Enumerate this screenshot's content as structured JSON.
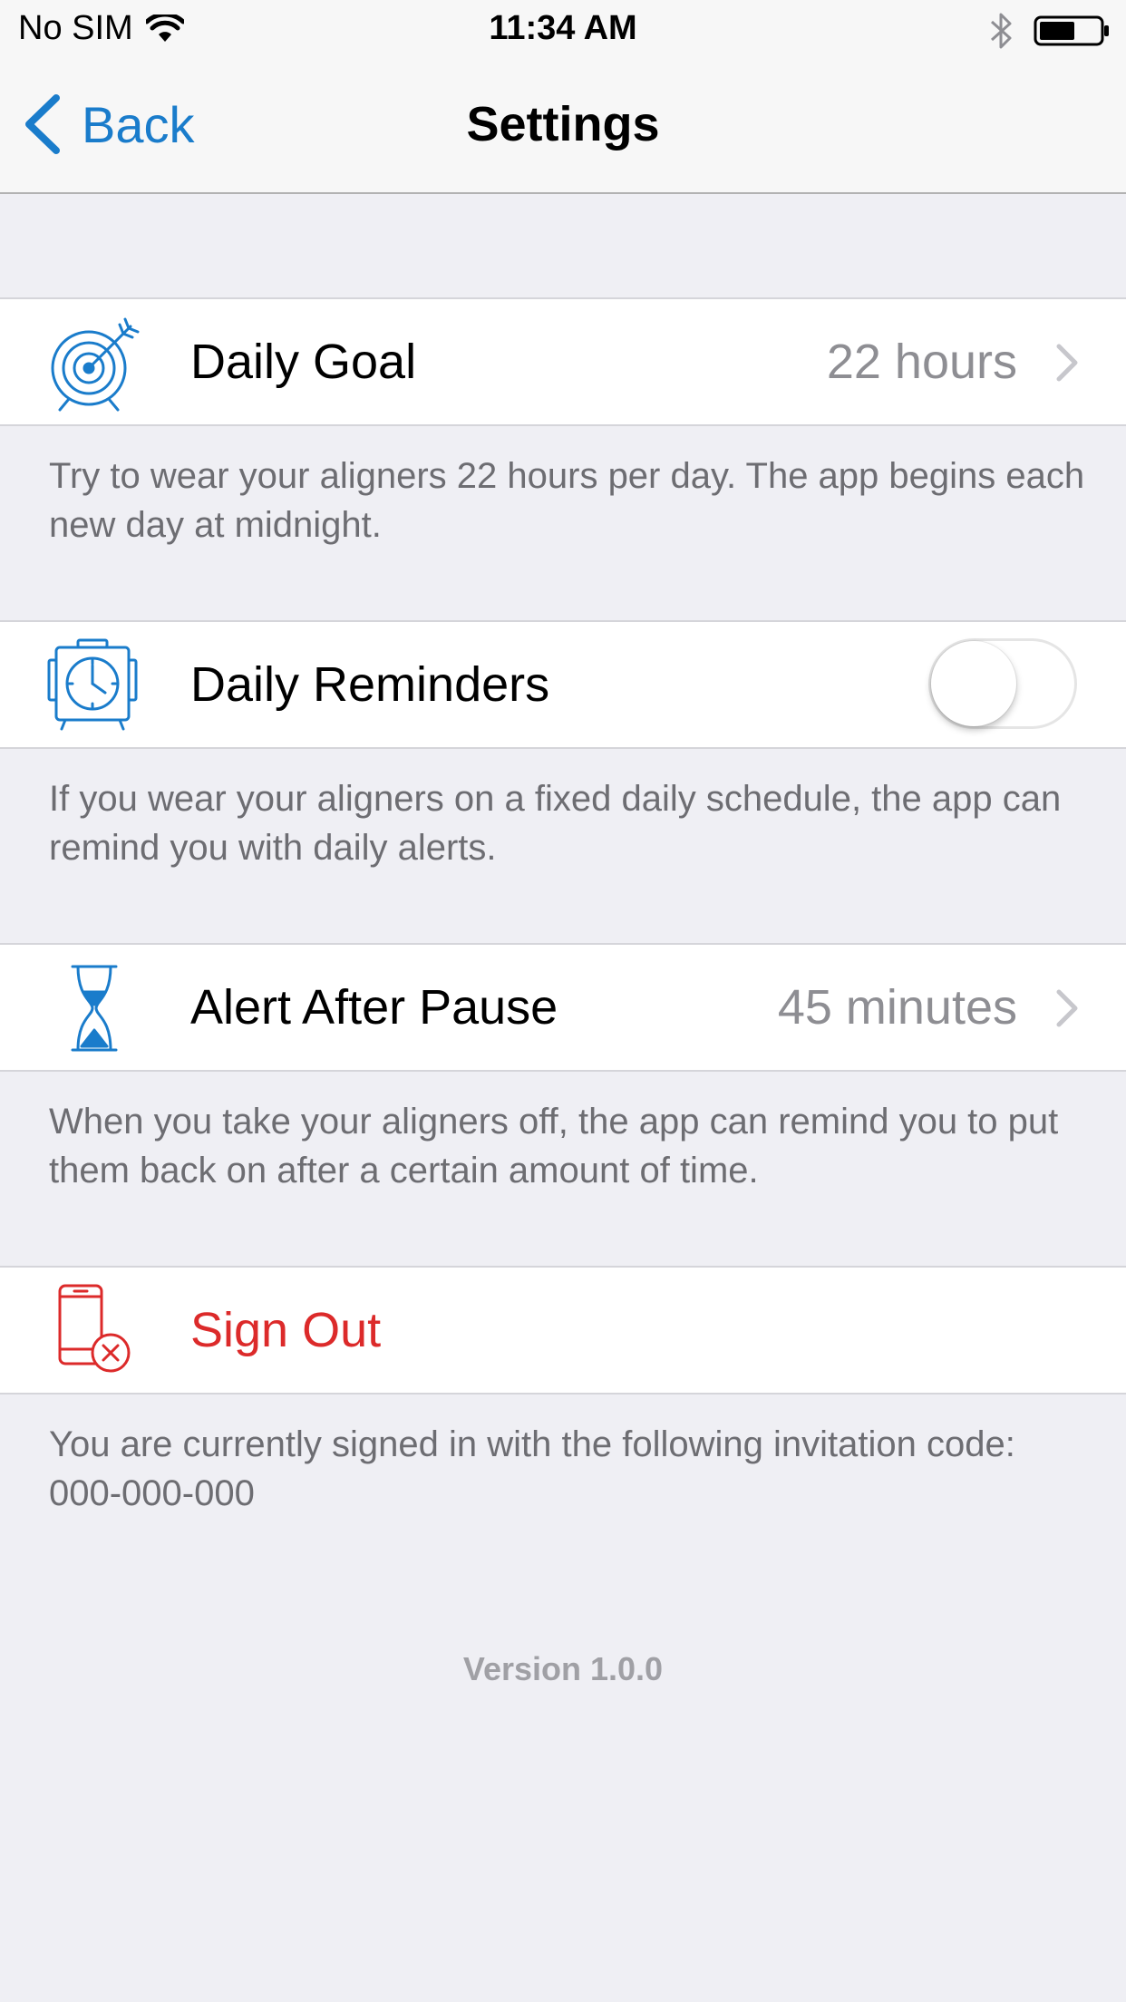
{
  "status_bar": {
    "carrier": "No SIM",
    "time": "11:34 AM",
    "battery_level": 0.6
  },
  "nav": {
    "back_label": "Back",
    "title": "Settings"
  },
  "colors": {
    "accent": "#1a7ccb",
    "danger": "#dc2a2a",
    "background": "#efeff4"
  },
  "sections": [
    {
      "icon": "target-icon",
      "label": "Daily Goal",
      "value": "22 hours",
      "footer": "Try to wear your aligners 22 hours per day. The app begins each new day at midnight."
    },
    {
      "icon": "alarm-clock-icon",
      "label": "Daily Reminders",
      "toggle_on": false,
      "footer": "If you wear your aligners on a fixed daily schedule, the app can remind you with daily alerts."
    },
    {
      "icon": "hourglass-icon",
      "label": "Alert After Pause",
      "value": "45 minutes",
      "footer": "When you take your aligners off, the app can remind you to put them back on after a certain amount of time."
    },
    {
      "icon": "phone-signout-icon",
      "label": "Sign Out",
      "footer": "You are currently signed in with the following invitation code: 000-000-000"
    }
  ],
  "version": "Version 1.0.0"
}
